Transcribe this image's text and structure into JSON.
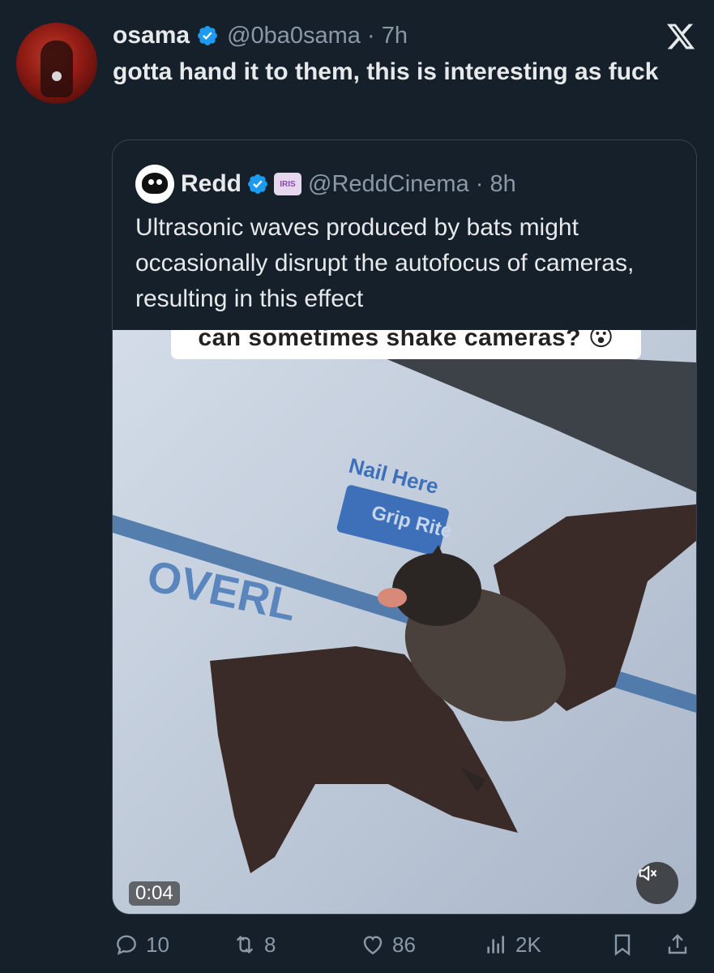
{
  "tweet": {
    "author_name": "osama",
    "author_handle": "@0ba0sama",
    "time": "7h",
    "text": "gotta hand it to them, this is interesting as fuck"
  },
  "quote": {
    "author_name": "Redd",
    "badge_label": "IRIS",
    "author_handle": "@ReddCinema",
    "time": "8h",
    "text": "Ultrasonic waves produced by bats might occasionally disrupt the autofocus of cameras, resulting in this effect",
    "media": {
      "caption": "can sometimes shake cameras? 😮",
      "sign_text_1": "Nail Here",
      "sign_text_2": "Grip Rite",
      "sign_text_3": "OVERL",
      "timer": "0:04"
    }
  },
  "actions": {
    "replies": "10",
    "reposts": "8",
    "likes": "86",
    "views": "2K"
  },
  "colors": {
    "background": "#15202b",
    "verified": "#1d9bf0",
    "muted_text": "#8b98a5"
  },
  "icons": [
    "x-logo-icon",
    "verified-badge-icon",
    "reply-icon",
    "repost-icon",
    "like-icon",
    "views-icon",
    "bookmark-icon",
    "share-icon",
    "mute-icon"
  ]
}
